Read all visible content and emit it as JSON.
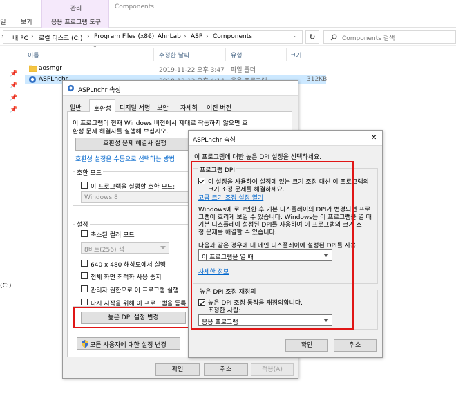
{
  "explorer": {
    "ribbon": {
      "context_header": "관리",
      "context_subtab": "응용 프로그램 도구",
      "tab_file": "파일",
      "tab_view": "보기",
      "window_title": "Components"
    },
    "breadcrumb": [
      "내 PC",
      "로컬 디스크 (C:)",
      "Program Files (x86)",
      "AhnLab",
      "ASP",
      "Components"
    ],
    "search_placeholder": "Components 검색",
    "columns": {
      "name": "이름",
      "modified": "수정한 날짜",
      "type": "유형",
      "size": "크기"
    },
    "files": [
      {
        "name": "aosmgr",
        "modified": "2019-11-22 오후 3:47",
        "type": "파일 폴더",
        "size": ""
      },
      {
        "name": "ASPLnchr",
        "modified": "2018-12-12 오후 4:14",
        "type": "응용 프로그램",
        "size": "312KB"
      }
    ],
    "nav_drive_label": "(C:)"
  },
  "props_dialog": {
    "title": "ASPLnchr 속성",
    "tabs": [
      "일반",
      "호환성",
      "디지털 서명",
      "보안",
      "자세히",
      "이전 버전"
    ],
    "active_tab": "호환성",
    "intro_line1": "이 프로그램이 현재 Windows 버전에서 제대로 작동하지 않으면 호",
    "intro_line2": "환성 문제 해결사를 실행해 보십시오.",
    "troubleshooter_button": "호환성 문제 해결사 실행",
    "manual_link": "호환성 설정을 수동으로 선택하는 방법",
    "compat_mode_group": "호환 모드",
    "compat_mode_checkbox": "이 프로그램을 실행할 호환 모드:",
    "compat_mode_value": "Windows 8",
    "settings_group": "설정",
    "settings": {
      "reduced_color": "축소된 컬러 모드",
      "color_value": "8비트(256) 색",
      "res_640": "640 x 480 해상도에서 실행",
      "fullscreen_opt": "전체 화면 최적화 사용 중지",
      "run_admin": "관리자 권한으로 이 프로그램 실행",
      "register_restart": "다시 시작을 위해 이 프로그램을 등록"
    },
    "high_dpi_button": "높은 DPI 설정 변경",
    "all_users_button": "모든 사용자에 대한 설정 변경",
    "ok": "확인",
    "cancel": "취소",
    "apply": "적용(A)"
  },
  "dpi_dialog": {
    "title": "ASPLnchr 속성",
    "close_glyph": "✕",
    "intro": "이 프로그램에 대한 높은 DPI 설정을 선택하세요.",
    "program_dpi_group": "프로그램 DPI",
    "program_dpi_checkbox_line1": "이 설정을 사용하여 설정에 있는 크기 조정 대신 이 프로그램의",
    "program_dpi_checkbox_line2": "크기 조정 문제를 해결하세요.",
    "advanced_scaling_link": "고급 크기 조정 설정 열기",
    "explain_line1": "Windows에 로그인한 후 기본 디스플레이의 DPI가 변경되면 프로",
    "explain_line2": "그램이 흐리게 보일 수 있습니다. Windows는 이 프로그램을 열 때",
    "explain_line3": "기본 디스플레이 설정된 DPI를 사용하여 이 프로그램의 크기 조",
    "explain_line4": "정 문제를 해결할 수 있습니다.",
    "use_dpi_label": "다음과 같은 경우에 내 메인 디스플레이에 설정된 DPI를 사용",
    "use_dpi_value": "이 프로그램을 열 때",
    "more_info_link": "자세한 정보",
    "override_group": "높은 DPI 조정 재정의",
    "override_checkbox": "높은 DPI 조정 동작을 재정의합니다.",
    "scaling_by_label": "조정한 사람:",
    "scaling_by_value": "응용 프로그램",
    "ok": "확인",
    "cancel": "취소"
  }
}
